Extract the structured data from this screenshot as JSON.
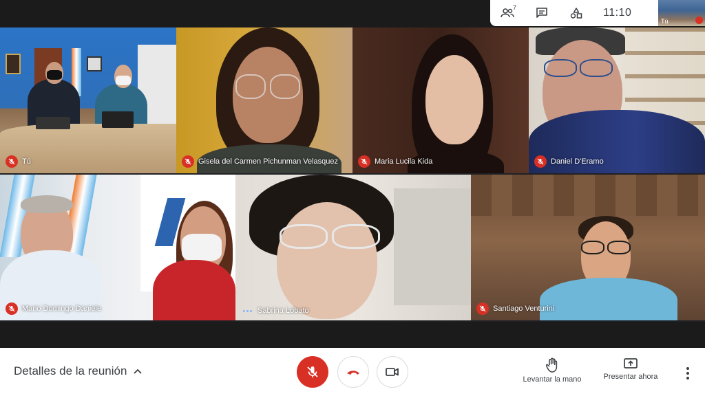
{
  "top": {
    "participants_count": "7",
    "clock": "11:10",
    "self_thumb_label": "Tú"
  },
  "tiles": [
    {
      "name": "Tú",
      "muted": true
    },
    {
      "name": "Gisela del Carmen Pichunman Velasquez",
      "muted": true
    },
    {
      "name": "Maria Lucila Kida",
      "muted": true
    },
    {
      "name": "Daniel D'Eramo",
      "muted": true
    },
    {
      "name": "Mario Domingo Daniele",
      "muted": true
    },
    {
      "name": "Sabrina Lobato",
      "muted": false,
      "speaking": true
    },
    {
      "name": "Santiago Venturini",
      "muted": true
    }
  ],
  "bottom": {
    "details_label": "Detalles de la reunión",
    "raise_hand_label": "Levantar la mano",
    "present_label": "Presentar ahora"
  },
  "colors": {
    "mute_red": "#d93025",
    "bar_white": "#ffffff",
    "text_dark": "#3c4043",
    "speaking_blue": "#8ab4f8"
  },
  "icons": [
    "people-icon",
    "chat-icon",
    "activities-icon",
    "mic-off-icon",
    "hang-up-icon",
    "camera-icon",
    "raise-hand-icon",
    "present-screen-icon",
    "more-vert-icon",
    "chevron-up-icon"
  ]
}
